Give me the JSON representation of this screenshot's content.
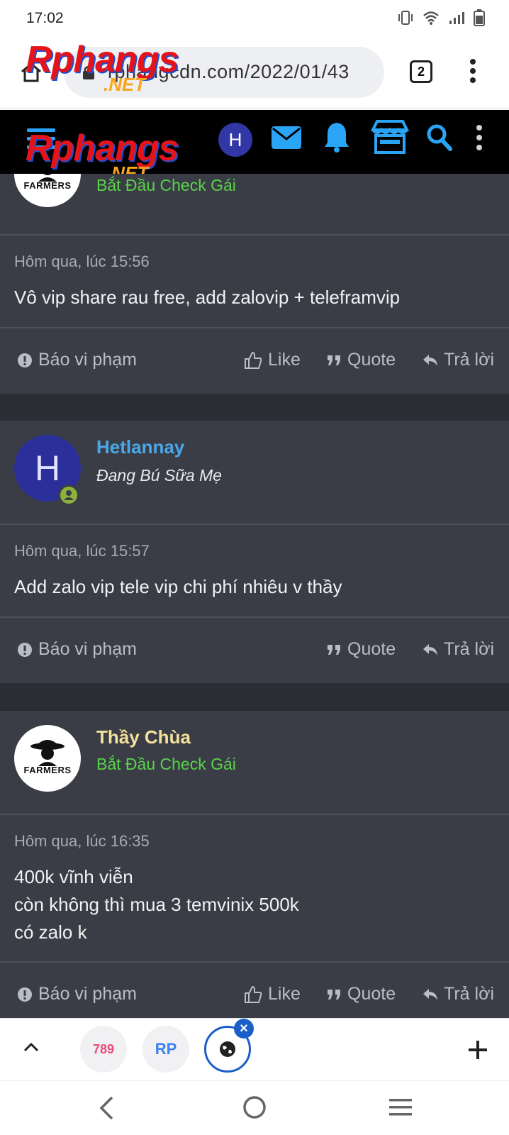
{
  "status_bar": {
    "time": "17:02"
  },
  "address_bar": {
    "url": "rphangcdn.com/2022/01/43",
    "tab_count": "2"
  },
  "logo": {
    "word": "Rphangs",
    "suffix": ".NET"
  },
  "site_header": {
    "avatar_letter": "H"
  },
  "posts": [
    {
      "author": "",
      "user_title": "Bắt Đầu Check Gái",
      "avatar_label": "FARMERS",
      "timestamp": "Hôm qua, lúc 15:56",
      "message_lines": [
        "Vô vip share rau free, add zalovip + teleframvip"
      ],
      "actions": {
        "report": "Báo vi phạm",
        "like": "Like",
        "quote": "Quote",
        "reply": "Trả lời"
      }
    },
    {
      "author": "Hetlannay",
      "user_title": "Đang Bú Sữa Mẹ",
      "avatar_letter": "H",
      "timestamp": "Hôm qua, lúc 15:57",
      "message_lines": [
        "Add zalo vip tele vip chi phí nhiêu v thầy"
      ],
      "actions": {
        "report": "Báo vi phạm",
        "quote": "Quote",
        "reply": "Trả lời"
      }
    },
    {
      "author": "Thầy Chùa",
      "user_title": "Bắt Đầu Check Gái",
      "avatar_label": "FARMERS",
      "timestamp": "Hôm qua, lúc 16:35",
      "message_lines": [
        "400k vĩnh viễn",
        "còn không thì mua 3 temvinix 500k",
        "có zalo k"
      ],
      "actions": {
        "report": "Báo vi phạm",
        "like": "Like",
        "quote": "Quote",
        "reply": "Trả lời"
      }
    }
  ],
  "bottom_tabs": [
    {
      "label": "789"
    },
    {
      "label": "RP"
    },
    {
      "label": ""
    }
  ],
  "colors": {
    "username_blue": "#4aa8e8",
    "username_yellow": "#f3e29a",
    "title_green": "#59d34a",
    "content_bg": "#3a3d45",
    "header_bg": "#000000"
  }
}
